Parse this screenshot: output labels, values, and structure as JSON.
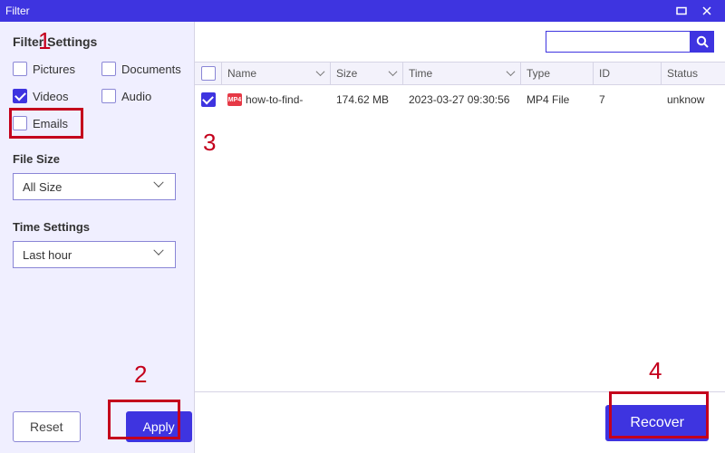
{
  "window": {
    "title": "Filter"
  },
  "sidebar": {
    "title": "Filter Settings",
    "filters": [
      {
        "label": "Pictures",
        "checked": false
      },
      {
        "label": "Documents",
        "checked": false
      },
      {
        "label": "Videos",
        "checked": true
      },
      {
        "label": "Audio",
        "checked": false
      },
      {
        "label": "Emails",
        "checked": false
      }
    ],
    "filesize_label": "File Size",
    "filesize_value": "All Size",
    "time_label": "Time Settings",
    "time_value": "Last hour",
    "reset_label": "Reset",
    "apply_label": "Apply"
  },
  "search": {
    "placeholder": ""
  },
  "table": {
    "headers": [
      "Name",
      "Size",
      "Time",
      "Type",
      "ID",
      "Status"
    ],
    "rows": [
      {
        "checked": true,
        "icon_text": "MP4",
        "name": "how-to-find-",
        "size": "174.62 MB",
        "time": "2023-03-27 09:30:56",
        "type": "MP4 File",
        "id": "7",
        "status": "unknow"
      }
    ]
  },
  "recover_label": "Recover",
  "annotations": {
    "n1": "1",
    "n2": "2",
    "n3": "3",
    "n4": "4"
  }
}
